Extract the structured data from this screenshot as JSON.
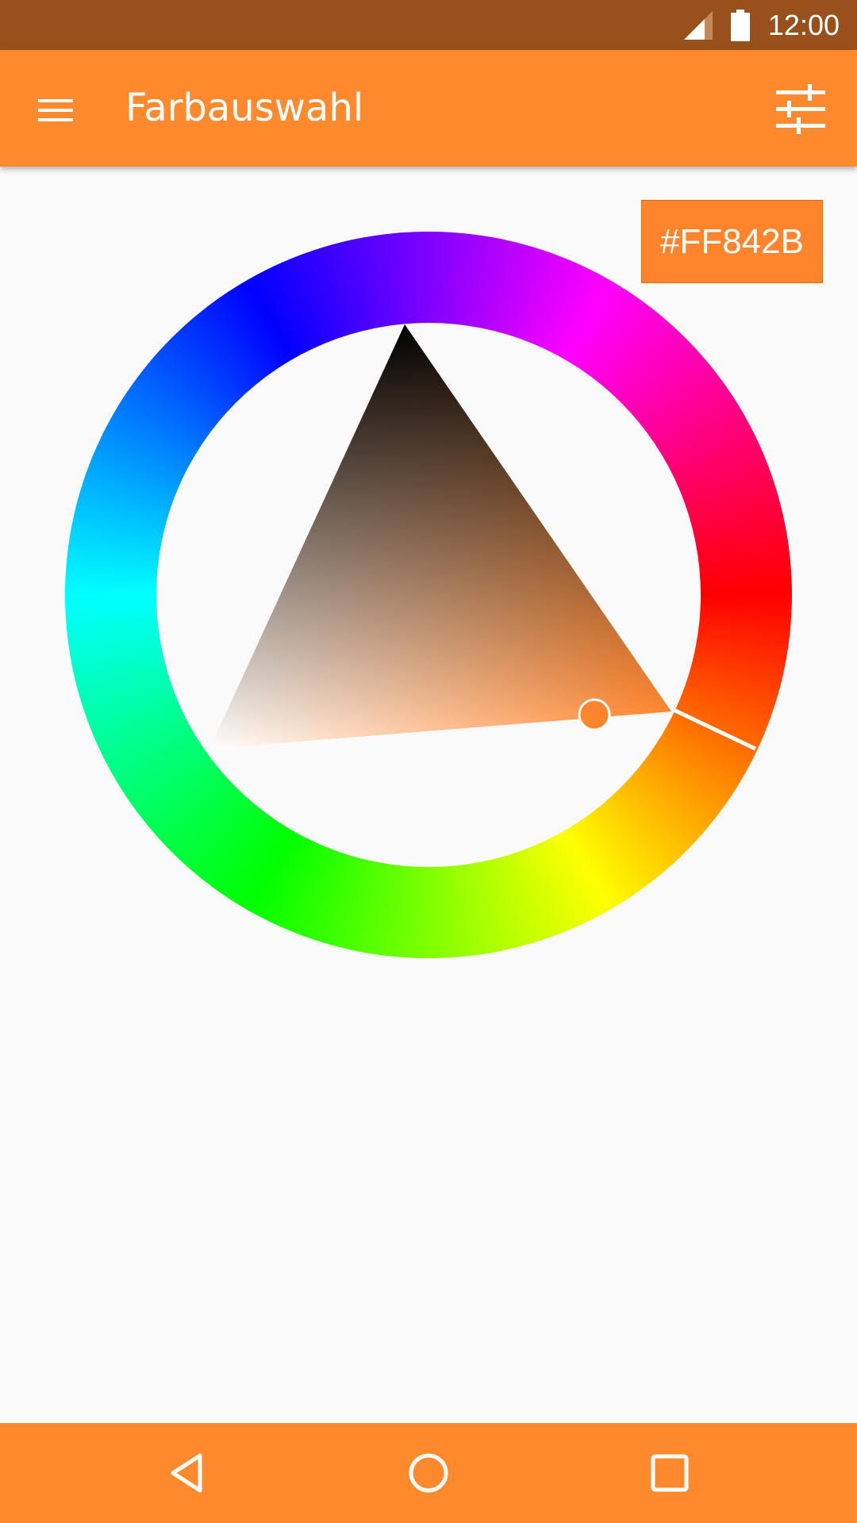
{
  "status_bar": {
    "time": "12:00",
    "icons": [
      "signal-icon",
      "battery-icon"
    ]
  },
  "app_bar": {
    "title": "Farbauswahl",
    "menu_icon": "menu-icon",
    "settings_icon": "tune-icon"
  },
  "color_picker": {
    "hex_value": "#FF842B",
    "selected_color": "#ff842b"
  },
  "nav_bar": {
    "icons": [
      "back-icon",
      "home-icon",
      "recents-icon"
    ]
  },
  "colors": {
    "status_bar": "#98501c",
    "app_bar": "#ff8a2d",
    "background": "#fafafa",
    "accent": "#ff842b"
  }
}
